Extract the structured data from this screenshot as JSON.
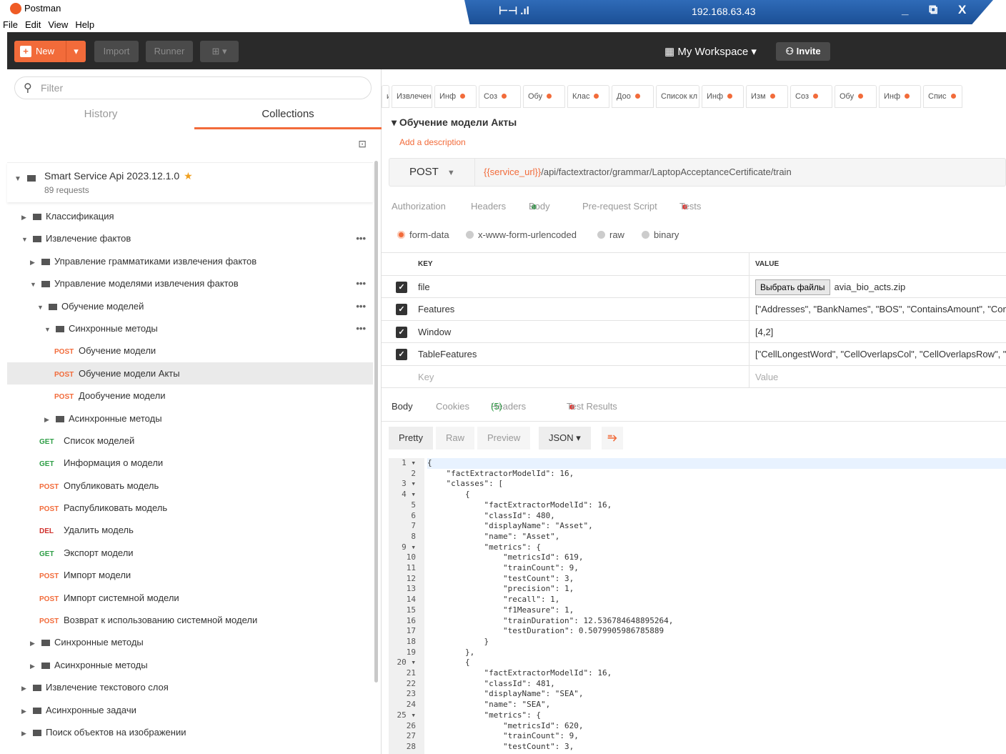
{
  "window": {
    "app_name": "Postman",
    "rdp_ip": "192.168.63.43",
    "rdp_pin": "⊢⊣ .ıl",
    "rdp_controls": "_ ⧉ X"
  },
  "menu": [
    "File",
    "Edit",
    "View",
    "Help"
  ],
  "toolbar": {
    "new_label": "New",
    "import_label": "Import",
    "runner_label": "Runner",
    "workspace_label": "My Workspace ▾",
    "invite_label": "Invite"
  },
  "sidebar": {
    "filter_placeholder": "Filter",
    "tab_history": "History",
    "tab_collections": "Collections",
    "collection": {
      "name": "Smart Service Api 2023.12.1.0",
      "count": "89 requests"
    },
    "items": [
      {
        "type": "folder",
        "level": 0,
        "open": false,
        "label": "Классификация"
      },
      {
        "type": "folder",
        "level": 0,
        "open": true,
        "label": "Извлечение фактов",
        "dots": true
      },
      {
        "type": "folder",
        "level": 1,
        "open": false,
        "label": "Управление грамматиками извлечения фактов"
      },
      {
        "type": "folder",
        "level": 1,
        "open": true,
        "label": "Управление моделями извлечения фактов",
        "dots": true
      },
      {
        "type": "folder",
        "level": 2,
        "open": true,
        "label": "Обучение моделей",
        "dots": true
      },
      {
        "type": "folder",
        "level": 3,
        "open": true,
        "label": "Синхронные методы",
        "dots": true
      },
      {
        "type": "request",
        "level": 4,
        "method": "POST",
        "label": "Обучение модели"
      },
      {
        "type": "request",
        "level": 4,
        "method": "POST",
        "label": "Обучение модели Акты",
        "selected": true
      },
      {
        "type": "request",
        "level": 4,
        "method": "POST",
        "label": "Дообучение модели"
      },
      {
        "type": "folder",
        "level": 3,
        "open": false,
        "label": "Асинхронные методы"
      },
      {
        "type": "request",
        "level": 2,
        "method": "GET",
        "label": "Список моделей"
      },
      {
        "type": "request",
        "level": 2,
        "method": "GET",
        "label": "Информация о модели"
      },
      {
        "type": "request",
        "level": 2,
        "method": "POST",
        "label": "Опубликовать модель"
      },
      {
        "type": "request",
        "level": 2,
        "method": "POST",
        "label": "Распубликовать модель"
      },
      {
        "type": "request",
        "level": 2,
        "method": "DEL",
        "label": "Удалить модель"
      },
      {
        "type": "request",
        "level": 2,
        "method": "GET",
        "label": "Экспорт модели"
      },
      {
        "type": "request",
        "level": 2,
        "method": "POST",
        "label": "Импорт модели"
      },
      {
        "type": "request",
        "level": 2,
        "method": "POST",
        "label": "Импорт системной модели"
      },
      {
        "type": "request",
        "level": 2,
        "method": "POST",
        "label": "Возврат к использованию системной модели"
      },
      {
        "type": "folder",
        "level": 1,
        "open": false,
        "label": "Синхронные методы"
      },
      {
        "type": "folder",
        "level": 1,
        "open": false,
        "label": "Асинхронные методы"
      },
      {
        "type": "folder",
        "level": 0,
        "open": false,
        "label": "Извлечение текстового слоя"
      },
      {
        "type": "folder",
        "level": 0,
        "open": false,
        "label": "Асинхронные задачи"
      },
      {
        "type": "folder",
        "level": 0,
        "open": false,
        "label": "Поиск объектов на изображении"
      }
    ]
  },
  "request_tabs": [
    {
      "label": "и",
      "dot": false
    },
    {
      "label": "Извлечені",
      "dot": false
    },
    {
      "label": "Инф",
      "dot": true
    },
    {
      "label": "Coз",
      "dot": true
    },
    {
      "label": "Обу",
      "dot": true
    },
    {
      "label": "Клас",
      "dot": true
    },
    {
      "label": "Доо",
      "dot": true
    },
    {
      "label": "Список кл",
      "dot": false
    },
    {
      "label": "Инф",
      "dot": true
    },
    {
      "label": "Изм",
      "dot": true
    },
    {
      "label": "Coз",
      "dot": true
    },
    {
      "label": "Обу",
      "dot": true
    },
    {
      "label": "Инф",
      "dot": true
    },
    {
      "label": "Спис",
      "dot": true
    }
  ],
  "request": {
    "title": "▾ Обучение модели Акты",
    "add_description": "Add a description",
    "method": "POST",
    "url_var": "{{service_url}}",
    "url_path": "/api/factextractor/grammar/LaptopAcceptanceCertificate/train",
    "tabs": {
      "authorization": "Authorization",
      "headers": "Headers",
      "body": "Body",
      "prerequest": "Pre-request Script",
      "tests": "Tests"
    },
    "body_modes": [
      "form-data",
      "x-www-form-urlencoded",
      "raw",
      "binary"
    ],
    "kv_header": {
      "key": "KEY",
      "value": "VALUE"
    },
    "kv": [
      {
        "key": "file",
        "value": "avia_bio_acts.zip",
        "button": "Выбрать файлы"
      },
      {
        "key": "Features",
        "value": "[\"Addresses\", \"BankNames\", \"BOS\", \"ContainsAmount\", \"Con"
      },
      {
        "key": "Window",
        "value": "[4,2]"
      },
      {
        "key": "TableFeatures",
        "value": "[\"CellLongestWord\", \"CellOverlapsCol\", \"CellOverlapsRow\", \"("
      }
    ],
    "kv_placeholder": {
      "key": "Key",
      "value": "Value"
    }
  },
  "response": {
    "tabs": {
      "body": "Body",
      "cookies": "Cookies",
      "headers": "Headers",
      "headers_count": "(5)",
      "test_results": "Test Results"
    },
    "formats": {
      "pretty": "Pretty",
      "raw": "Raw",
      "preview": "Preview",
      "json": "JSON ▾"
    },
    "line_numbers": [
      "1 ▾",
      "2",
      "3 ▾",
      "4 ▾",
      "5",
      "6",
      "7",
      "8",
      "9 ▾",
      "10",
      "11",
      "12",
      "13",
      "14",
      "15",
      "16",
      "17",
      "18",
      "19",
      "20 ▾",
      "21",
      "22",
      "23",
      "24",
      "25 ▾",
      "26",
      "27",
      "28"
    ],
    "code_lines": [
      "{",
      "    \"factExtractorModelId\": 16,",
      "    \"classes\": [",
      "        {",
      "            \"factExtractorModelId\": 16,",
      "            \"classId\": 480,",
      "            \"displayName\": \"Asset\",",
      "            \"name\": \"Asset\",",
      "            \"metrics\": {",
      "                \"metricsId\": 619,",
      "                \"trainCount\": 9,",
      "                \"testCount\": 3,",
      "                \"precision\": 1,",
      "                \"recall\": 1,",
      "                \"f1Measure\": 1,",
      "                \"trainDuration\": 12.536784648895264,",
      "                \"testDuration\": 0.5079905986785889",
      "            }",
      "        },",
      "        {",
      "            \"factExtractorModelId\": 16,",
      "            \"classId\": 481,",
      "            \"displayName\": \"SEA\",",
      "            \"name\": \"SEA\",",
      "            \"metrics\": {",
      "                \"metricsId\": 620,",
      "                \"trainCount\": 9,",
      "                \"testCount\": 3,"
    ]
  }
}
